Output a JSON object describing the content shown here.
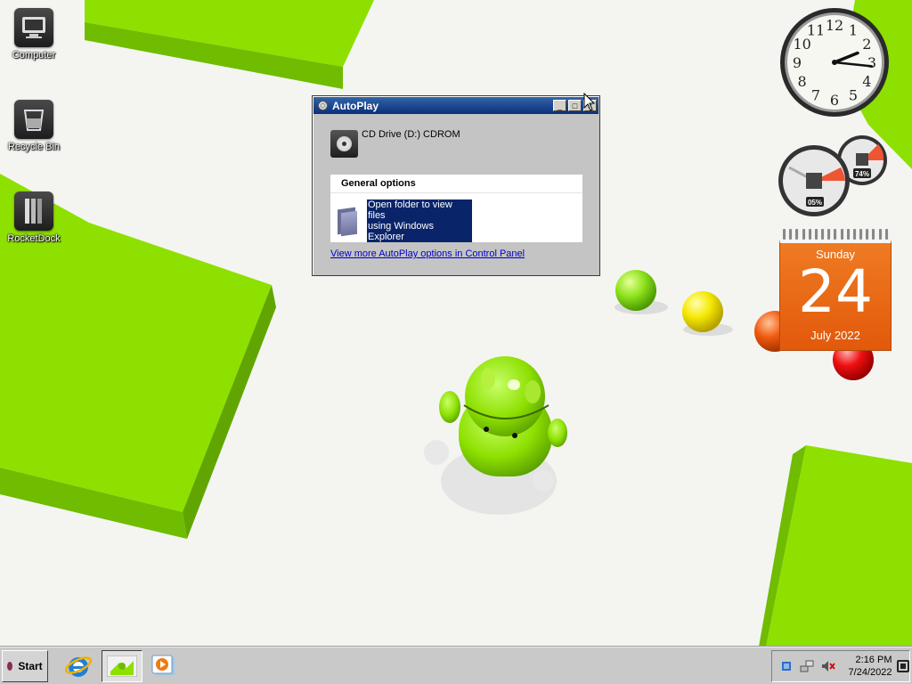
{
  "desktop": {
    "icons": [
      {
        "label": "Computer"
      },
      {
        "label": "Recycle Bin"
      },
      {
        "label": "RocketDock"
      }
    ]
  },
  "autoplay": {
    "title": "AutoPlay",
    "drive_label": "CD Drive (D:) CDROM",
    "section_title": "General options",
    "option_line1": "Open folder to view files",
    "option_line2": "using Windows Explorer",
    "more_link": "View more AutoPlay options in Control Panel"
  },
  "gadgets": {
    "clock": {
      "time": "2:16",
      "numbers": [
        "12",
        "1",
        "2",
        "3",
        "4",
        "5",
        "6",
        "7",
        "8",
        "9",
        "10",
        "11"
      ]
    },
    "cpu_meter": {
      "cpu_percent": "05%",
      "memory_percent": "74%"
    },
    "calendar": {
      "weekday": "Sunday",
      "day": "24",
      "month_year": "July 2022"
    }
  },
  "taskbar": {
    "start_label": "Start",
    "clock_time": "2:16 PM",
    "clock_date": "7/24/2022"
  },
  "colors": {
    "wallpaper_green": "#8ee000",
    "title_bar_blue": "#0a2f7a",
    "selection_blue": "#0a246a",
    "calendar_orange": "#e2590b"
  }
}
